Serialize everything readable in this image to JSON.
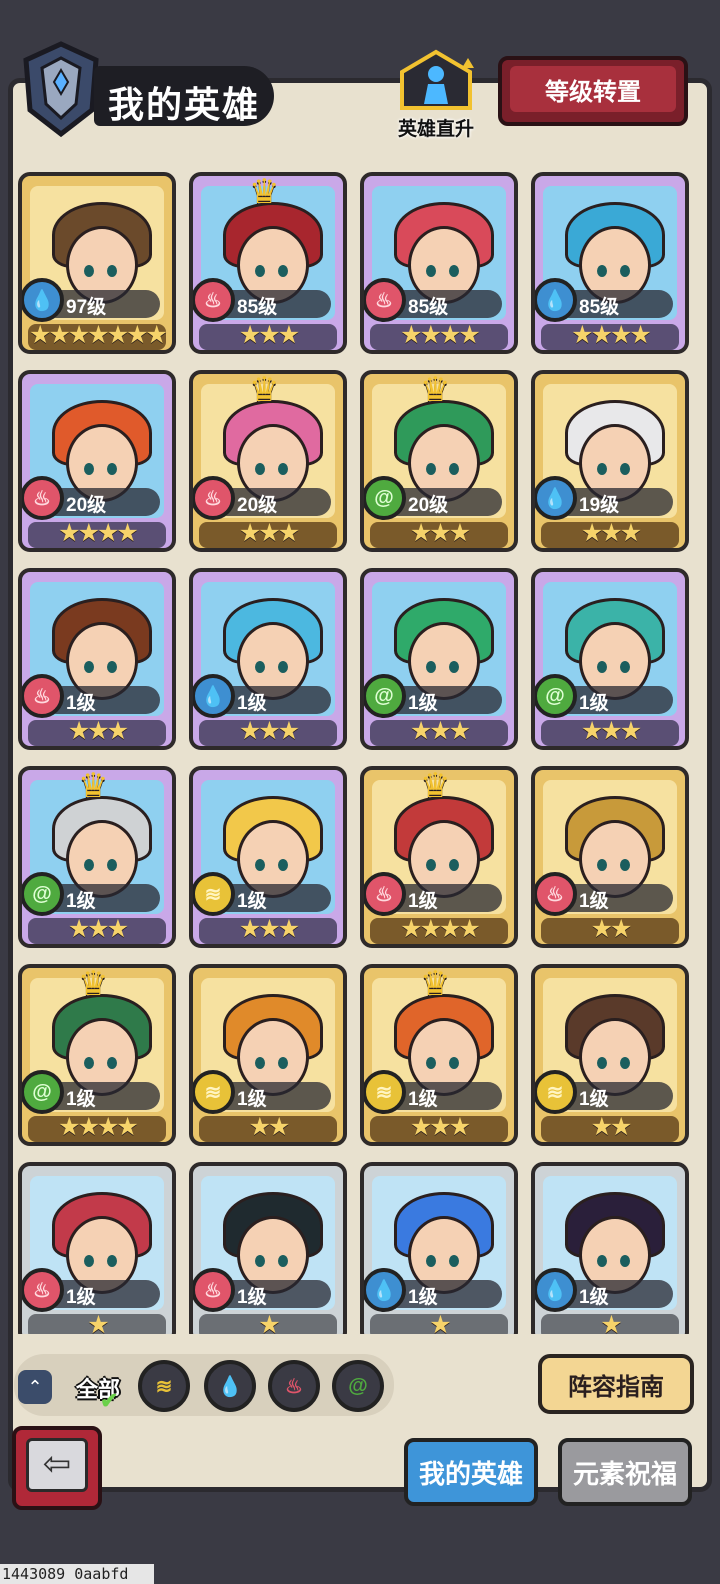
{
  "header": {
    "title": "我的英雄",
    "hero_up_label": "英雄直升",
    "level_transfer_label": "等级转置"
  },
  "heroes": [
    {
      "level": "97级",
      "element": "water",
      "stars": 7,
      "crown": false,
      "frame": "gold"
    },
    {
      "level": "85级",
      "element": "fire",
      "stars": 3,
      "crown": true,
      "frame": "purple"
    },
    {
      "level": "85级",
      "element": "fire",
      "stars": 4,
      "crown": false,
      "frame": "purple"
    },
    {
      "level": "85级",
      "element": "water",
      "stars": 4,
      "crown": false,
      "frame": "purple"
    },
    {
      "level": "20级",
      "element": "fire",
      "stars": 4,
      "crown": false,
      "frame": "purple"
    },
    {
      "level": "20级",
      "element": "fire",
      "stars": 3,
      "crown": true,
      "frame": "gold"
    },
    {
      "level": "20级",
      "element": "wind",
      "stars": 3,
      "crown": true,
      "frame": "gold"
    },
    {
      "level": "19级",
      "element": "water",
      "stars": 3,
      "crown": false,
      "frame": "gold"
    },
    {
      "level": "1级",
      "element": "fire",
      "stars": 3,
      "crown": false,
      "frame": "purple"
    },
    {
      "level": "1级",
      "element": "water",
      "stars": 3,
      "crown": false,
      "frame": "purple"
    },
    {
      "level": "1级",
      "element": "wind",
      "stars": 3,
      "crown": false,
      "frame": "purple"
    },
    {
      "level": "1级",
      "element": "wind",
      "stars": 3,
      "crown": false,
      "frame": "purple"
    },
    {
      "level": "1级",
      "element": "wind",
      "stars": 3,
      "crown": true,
      "frame": "purple"
    },
    {
      "level": "1级",
      "element": "earth",
      "stars": 3,
      "crown": false,
      "frame": "purple"
    },
    {
      "level": "1级",
      "element": "fire",
      "stars": 4,
      "crown": true,
      "frame": "gold"
    },
    {
      "level": "1级",
      "element": "fire",
      "stars": 2,
      "crown": false,
      "frame": "gold"
    },
    {
      "level": "1级",
      "element": "wind",
      "stars": 4,
      "crown": true,
      "frame": "gold"
    },
    {
      "level": "1级",
      "element": "earth",
      "stars": 2,
      "crown": false,
      "frame": "gold"
    },
    {
      "level": "1级",
      "element": "earth",
      "stars": 3,
      "crown": true,
      "frame": "gold"
    },
    {
      "level": "1级",
      "element": "earth",
      "stars": 2,
      "crown": false,
      "frame": "gold"
    },
    {
      "level": "1级",
      "element": "fire",
      "stars": 1,
      "crown": false,
      "frame": "silver"
    },
    {
      "level": "1级",
      "element": "fire",
      "stars": 1,
      "crown": false,
      "frame": "silver"
    },
    {
      "level": "1级",
      "element": "water",
      "stars": 1,
      "crown": false,
      "frame": "silver"
    },
    {
      "level": "1级",
      "element": "water",
      "stars": 1,
      "crown": false,
      "frame": "silver"
    }
  ],
  "filters": {
    "all_label": "全部",
    "elements": [
      "earth",
      "water",
      "fire",
      "wind"
    ]
  },
  "lineup_guide_label": "阵容指南",
  "tabs": {
    "my_heroes": "我的英雄",
    "element_blessing": "元素祝福"
  },
  "footer_id": "1443089 0aabfd",
  "colors": {
    "water": "#3e8fd1",
    "fire": "#e0556a",
    "wind": "#4faa3f",
    "earth": "#e8c238",
    "hair_palette": [
      "#6b4a2b",
      "#a8262e",
      "#d94a5a",
      "#3aa9d6",
      "#e05a2b",
      "#e06aa0",
      "#2f9a5a",
      "#e8e8ea",
      "#7a3a1f",
      "#4cb8e0",
      "#2faa6a",
      "#3bb3a8",
      "#cfd2d4",
      "#f2c84a",
      "#c23a3a",
      "#c89a3a",
      "#2f7a4a",
      "#e08a2a",
      "#e0652a",
      "#5a3a2a",
      "#c23a4a",
      "#1f2a2f",
      "#3a7ae0",
      "#2a1f3a"
    ]
  }
}
